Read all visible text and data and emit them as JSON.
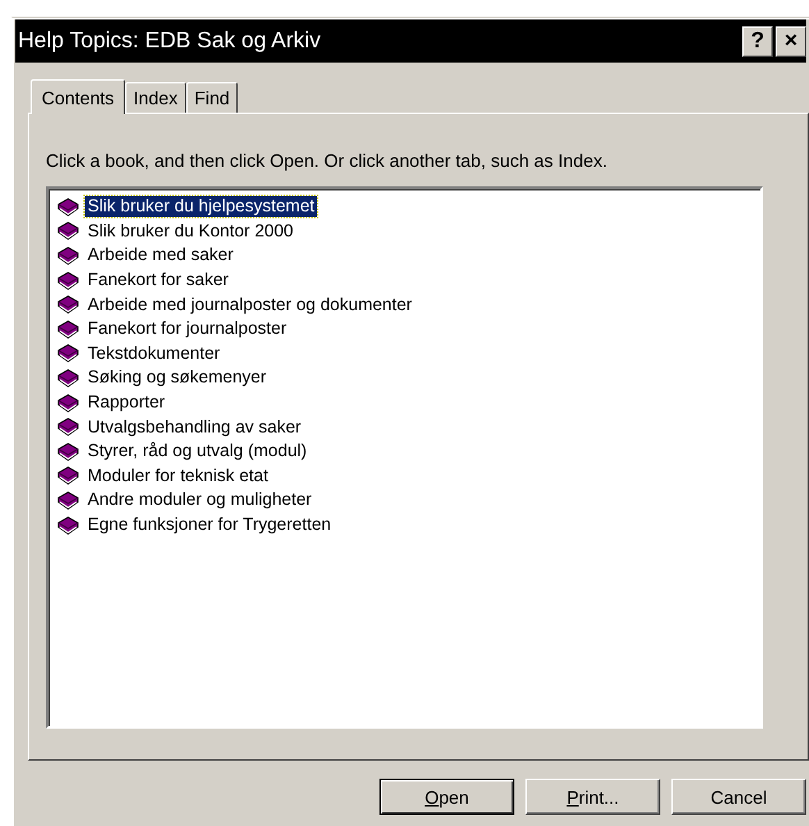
{
  "window": {
    "title": "Help Topics: EDB Sak og Arkiv",
    "title_buttons": [
      "?",
      "×"
    ]
  },
  "tabs": [
    {
      "label": "Contents",
      "selected": true
    },
    {
      "label": "Index",
      "selected": false
    },
    {
      "label": "Find",
      "selected": false
    }
  ],
  "instruction": "Click a book, and then click Open. Or click another tab, such as Index.",
  "topics": [
    {
      "label": "Slik bruker du hjelpesystemet",
      "selected": true
    },
    {
      "label": "Slik bruker du Kontor 2000",
      "selected": false
    },
    {
      "label": "Arbeide med saker",
      "selected": false
    },
    {
      "label": "Fanekort for saker",
      "selected": false
    },
    {
      "label": "Arbeide med journalposter og dokumenter",
      "selected": false
    },
    {
      "label": "Fanekort for journalposter",
      "selected": false
    },
    {
      "label": "Tekstdokumenter",
      "selected": false
    },
    {
      "label": "Søking og søkemenyer",
      "selected": false
    },
    {
      "label": "Rapporter",
      "selected": false
    },
    {
      "label": "Utvalgsbehandling av saker",
      "selected": false
    },
    {
      "label": "Styrer, råd og utvalg (modul)",
      "selected": false
    },
    {
      "label": "Moduler for teknisk etat",
      "selected": false
    },
    {
      "label": "Andre moduler og muligheter",
      "selected": false
    },
    {
      "label": "Egne funksjoner for Trygeretten",
      "selected": false
    }
  ],
  "buttons": [
    {
      "accel": "O",
      "rest": "pen",
      "default": true
    },
    {
      "accel": "P",
      "rest": "rint...",
      "default": false
    },
    {
      "rest": "Cancel",
      "default": false
    }
  ]
}
